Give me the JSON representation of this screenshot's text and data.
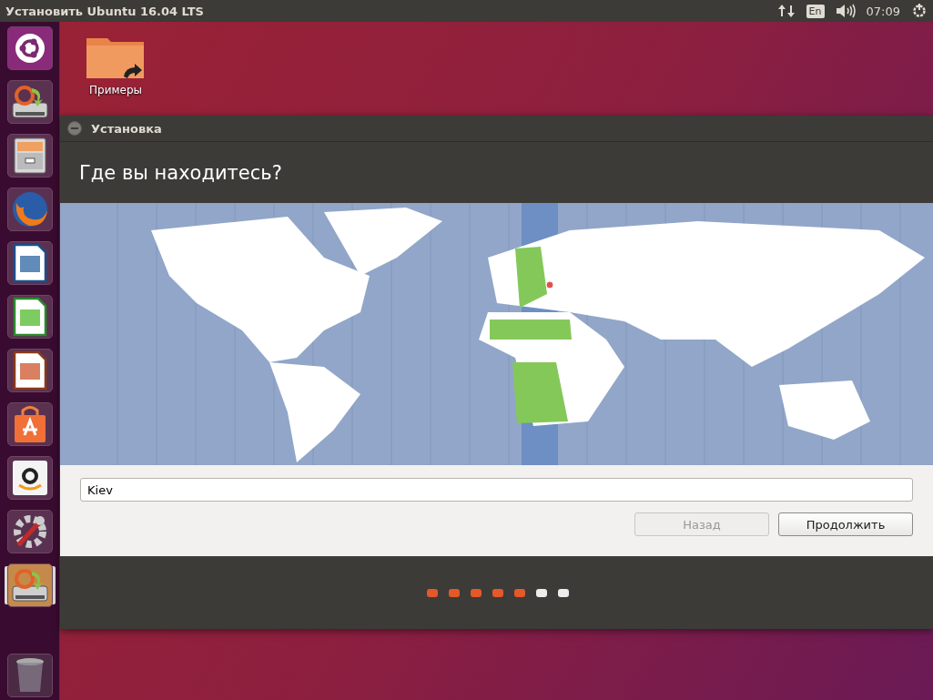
{
  "top_panel": {
    "title": "Установить Ubuntu 16.04 LTS",
    "keyboard_layout": "En",
    "time": "07:09"
  },
  "launcher": [
    {
      "kind": "dash",
      "selected": false
    },
    {
      "kind": "installer",
      "selected": false
    },
    {
      "kind": "files",
      "selected": false
    },
    {
      "kind": "firefox",
      "selected": false
    },
    {
      "kind": "writer",
      "selected": false
    },
    {
      "kind": "calc",
      "selected": false
    },
    {
      "kind": "impress",
      "selected": false
    },
    {
      "kind": "software",
      "selected": false
    },
    {
      "kind": "amazon",
      "selected": false
    },
    {
      "kind": "settings",
      "selected": false
    },
    {
      "kind": "installer",
      "selected": true
    }
  ],
  "desktop_icons": [
    {
      "label": "Примеры"
    }
  ],
  "window": {
    "title": "Установка",
    "heading": "Где вы находитесь?",
    "location": {
      "value": "Kiev"
    },
    "buttons": [
      {
        "label": "Назад",
        "disabled": true
      },
      {
        "label": "Продолжить",
        "disabled": false
      }
    ],
    "steps": [
      {
        "completed": true
      },
      {
        "completed": true
      },
      {
        "completed": true
      },
      {
        "completed": true
      },
      {
        "completed": true
      },
      {
        "completed": false
      },
      {
        "completed": false
      }
    ]
  }
}
